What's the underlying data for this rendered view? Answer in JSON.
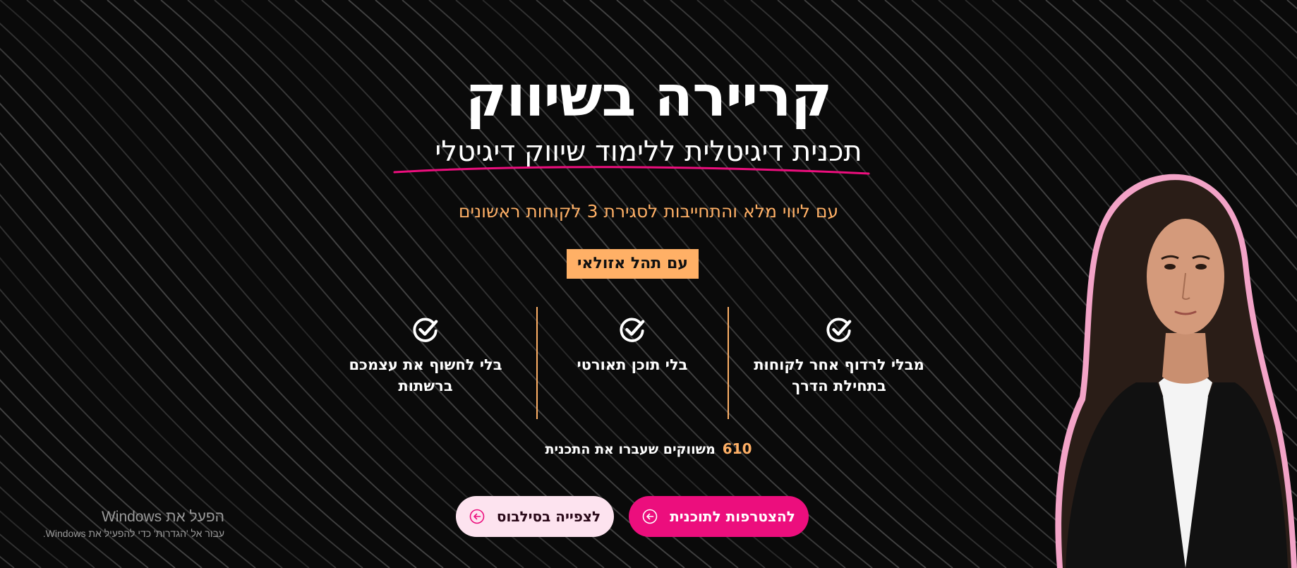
{
  "hero": {
    "title": "קריירה בשיווק",
    "subtitle": "תכנית דיגיטלית ללימוד שיווק דיגיטלי",
    "tagline": "עם ליווי מלא והתחייבות לסגירת 3 לקוחות ראשונים",
    "presenter": "עם תהל אזולאי"
  },
  "features": [
    {
      "text": "מבלי לרדוף אחר לקוחות בתחילת הדרך",
      "icon": "check-circle-icon"
    },
    {
      "text": "בלי תוכן תאורטי",
      "icon": "check-circle-icon"
    },
    {
      "text": "בלי לחשוף את עצמכם ברשתות",
      "icon": "check-circle-icon"
    }
  ],
  "stats": {
    "count": "610",
    "label": "משווקים שעברו את התכנית"
  },
  "buttons": {
    "join": "להצטרפות לתוכנית",
    "syllabus": "לצפייה בסילבוס"
  },
  "watermark": {
    "title": "הפעל את Windows",
    "subtitle": "עבור אל 'הגדרות' כדי להפעיל את Windows."
  },
  "colors": {
    "background": "#0a0a0a",
    "accent_orange": "#ffb066",
    "accent_pink": "#ec0e7d",
    "light_pink": "#fde3ef"
  }
}
